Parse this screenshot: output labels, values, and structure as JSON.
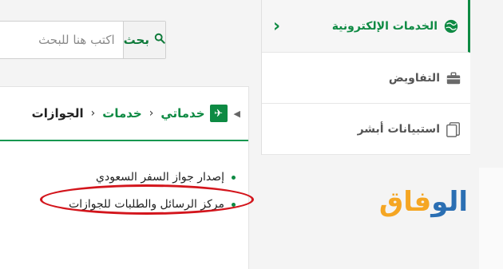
{
  "search": {
    "button_label": "بحث",
    "placeholder": "اكتب هنا للبحث"
  },
  "breadcrumb": {
    "items": [
      "خدماتي",
      "خدمات",
      "الجوازات"
    ]
  },
  "links": [
    "إصدار جواز السفر السعودي",
    "مركز الرسائل والطلبات للجوازات"
  ],
  "sidebar": {
    "items": [
      {
        "label": "الخدمات الإلكترونية",
        "active": true
      },
      {
        "label": "التفاويض",
        "active": false
      },
      {
        "label": "استبيانات أبشر",
        "active": false
      }
    ]
  },
  "logo": {
    "text_blue": "الو",
    "text_orange": "فاق"
  },
  "colors": {
    "accent": "#0e8a43",
    "highlight": "#d3151c",
    "logo_blue": "#2b6fb3",
    "logo_orange": "#f5a623"
  },
  "icons": {
    "search": "search-icon",
    "home": "passport-icon",
    "sidebar": [
      "globe-icon",
      "briefcase-icon",
      "survey-icon"
    ],
    "chevron": "chevron-left-icon"
  }
}
